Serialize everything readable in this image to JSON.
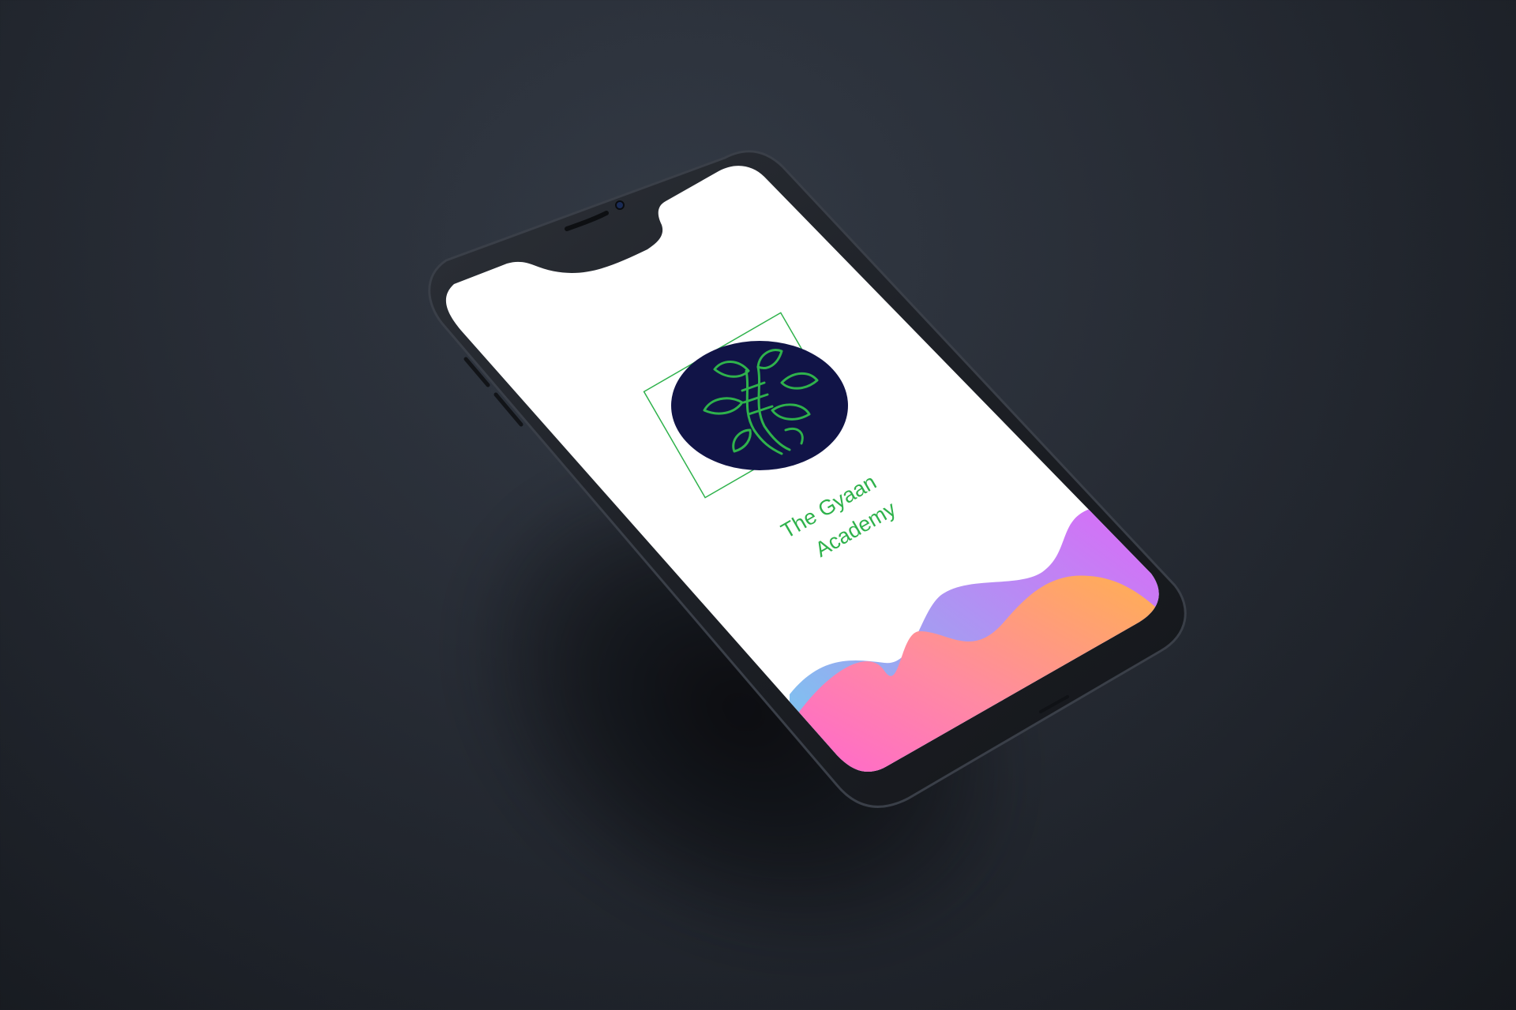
{
  "app": {
    "name_line1": "The Gyaan",
    "name_line2": "Academy"
  },
  "logo": {
    "icon": "leaf-tree-icon",
    "circle_color": "#111447",
    "line_color": "#2fb24c"
  },
  "colors": {
    "background": "#282d36",
    "phone_body": "#22262c",
    "screen": "#ffffff",
    "wave_purple": "#d96bf5",
    "wave_blue": "#8aa6f2",
    "wave_cyan": "#5ed2e8",
    "wave_pink": "#ff83a6",
    "wave_orange": "#ffaa55",
    "title_green": "#2fb24c"
  }
}
